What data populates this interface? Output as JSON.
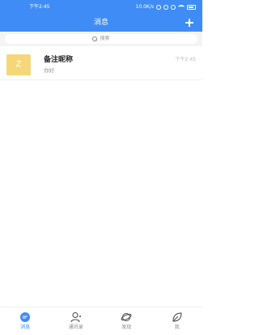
{
  "status_bar": {
    "time": "下午2:45",
    "network": "10.0K/s"
  },
  "header": {
    "title": "消息",
    "add_icon": "plus-icon"
  },
  "search": {
    "placeholder": "搜索",
    "icon": "search-icon"
  },
  "conversations": [
    {
      "avatar_letter": "Z",
      "avatar_color": "#f5d77a",
      "name": "备注昵称",
      "preview": "你好",
      "time": "下午2:45"
    }
  ],
  "bottom_nav": {
    "active_color": "#3f8cf6",
    "tabs": [
      {
        "label": "消息",
        "icon": "chat-bubble-icon",
        "active": true
      },
      {
        "label": "通讯录",
        "icon": "contacts-icon",
        "active": false
      },
      {
        "label": "发现",
        "icon": "discover-planet-icon",
        "active": false
      },
      {
        "label": "我",
        "icon": "leaf-icon",
        "active": false
      }
    ]
  }
}
